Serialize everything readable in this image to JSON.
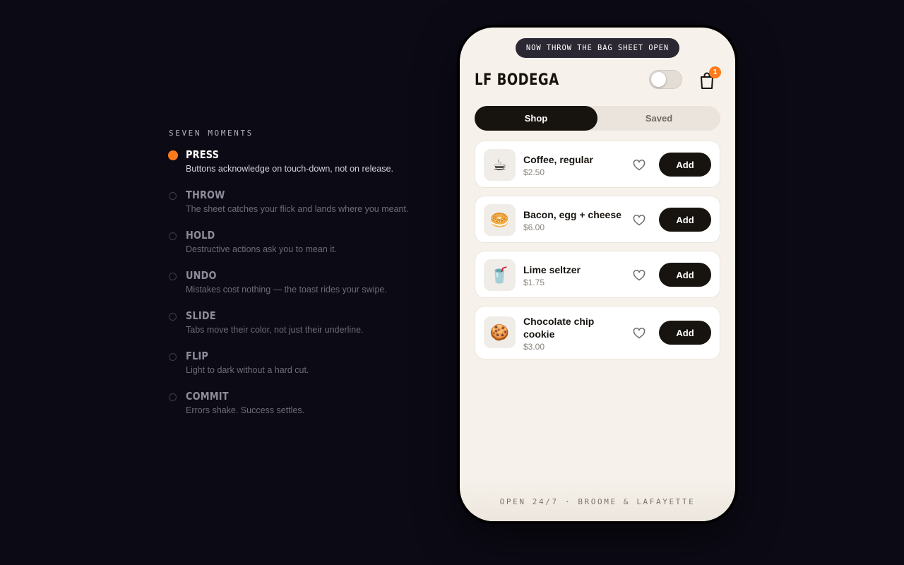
{
  "moments": {
    "title": "SEVEN MOMENTS",
    "items": [
      {
        "name": "PRESS",
        "desc": "Buttons acknowledge on touch-down, not on release.",
        "active": true
      },
      {
        "name": "THROW",
        "desc": "The sheet catches your flick and lands where you meant.",
        "active": false
      },
      {
        "name": "HOLD",
        "desc": "Destructive actions ask you to mean it.",
        "active": false
      },
      {
        "name": "UNDO",
        "desc": "Mistakes cost nothing — the toast rides your swipe.",
        "active": false
      },
      {
        "name": "SLIDE",
        "desc": "Tabs move their color, not just their underline.",
        "active": false
      },
      {
        "name": "FLIP",
        "desc": "Light to dark without a hard cut.",
        "active": false
      },
      {
        "name": "COMMIT",
        "desc": "Errors shake. Success settles.",
        "active": false
      }
    ]
  },
  "phone": {
    "pill": "NOW THROW THE BAG SHEET OPEN",
    "brand": "LF BODEGA",
    "bag_count": "1",
    "tabs": {
      "shop": "Shop",
      "saved": "Saved"
    },
    "items": [
      {
        "name": "Coffee, regular",
        "price": "$2.50",
        "icon": "☕",
        "add": "Add"
      },
      {
        "name": "Bacon, egg + cheese",
        "price": "$6.00",
        "icon": "🥯",
        "add": "Add"
      },
      {
        "name": "Lime seltzer",
        "price": "$1.75",
        "icon": "🥤",
        "add": "Add"
      },
      {
        "name": "Chocolate chip cookie",
        "price": "$3.00",
        "icon": "🍪",
        "add": "Add"
      }
    ],
    "footer": "OPEN 24/7 · BROOME & LAFAYETTE"
  },
  "colors": {
    "background": "#0c0a15",
    "accent": "#ff7a1a",
    "screen": "#f6f1ea",
    "ink": "#17130f"
  }
}
